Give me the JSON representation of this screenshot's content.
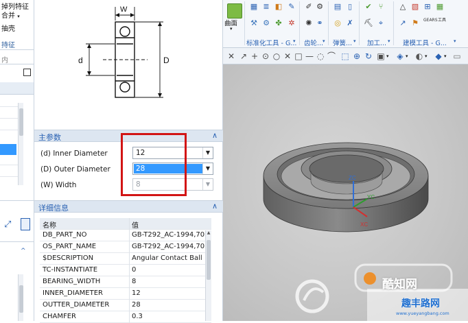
{
  "left_panel": {
    "item1": "掉列特征",
    "item2": "合并",
    "item3": "抽壳",
    "section": "持征",
    "field": "内"
  },
  "diagram": {
    "width_label": "W",
    "inner_label": "d",
    "outer_label": "D"
  },
  "main_params": {
    "header": "主参数",
    "params": [
      {
        "label": "(d) Inner Diameter",
        "value": "12"
      },
      {
        "label": "(D) Outer Diameter",
        "value": "28"
      },
      {
        "label": "(W) Width",
        "value": "8"
      }
    ]
  },
  "details": {
    "header": "详细信息",
    "columns": [
      "名称",
      "值"
    ],
    "rows": [
      [
        "DB_PART_NO",
        "GB-T292_AC-1994,70"
      ],
      [
        "OS_PART_NAME",
        "GB-T292_AC-1994,70"
      ],
      [
        "$DESCRIPTION",
        "Angular Contact Ball"
      ],
      [
        "TC-INSTANTIATE",
        "0"
      ],
      [
        "BEARING_WIDTH",
        "8"
      ],
      [
        "INNER_DIAMETER",
        "12"
      ],
      [
        "OUTTER_DIAMETER",
        "28"
      ],
      [
        "CHAMFER",
        "0.3"
      ]
    ]
  },
  "ribbon": {
    "surface_label": "曲面",
    "groups": [
      "标准化工具 - G...",
      "齿轮...",
      "弹簧...",
      "加工...",
      "建模工具 - G..."
    ],
    "gears_label": "GEARS",
    "tool_label": "工具"
  },
  "watermark": {
    "brand": "酷知网",
    "site_name": "趣丰路网",
    "url": "www.yueyangbang.com"
  },
  "colors": {
    "accent_blue": "#2a62b3",
    "selection": "#3399ff",
    "highlight_box": "#d21414",
    "viewport_bg": "#c6c6c6"
  }
}
